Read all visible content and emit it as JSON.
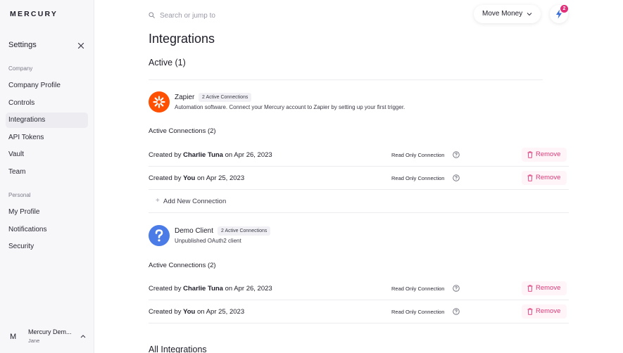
{
  "brand": "MERCURY",
  "sidebar": {
    "settings_title": "Settings",
    "company_label": "Company",
    "company_items": [
      "Company Profile",
      "Controls",
      "Integrations",
      "API Tokens",
      "Vault",
      "Team"
    ],
    "personal_label": "Personal",
    "personal_items": [
      "My Profile",
      "Notifications",
      "Security"
    ],
    "active_item": "Integrations",
    "account": {
      "avatar_letter": "M",
      "name": "Mercury Dem...",
      "user": "Jane"
    }
  },
  "topbar": {
    "search_placeholder": "Search or jump to",
    "move_money_label": "Move Money",
    "notifications_count": "2"
  },
  "main": {
    "title": "Integrations",
    "active_heading": "Active (1)",
    "all_heading": "All Integrations",
    "add_connection_label": "Add New Connection",
    "integrations": [
      {
        "name": "Zapier",
        "badge": "2 Active Connections",
        "description": "Automation software. Connect your Mercury account to Zapier by setting up your first trigger.",
        "logo_color": "#ff4f00",
        "connections_heading": "Active Connections (2)",
        "connections": [
          {
            "prefix": "Created by ",
            "creator": "Charlie Tuna",
            "suffix": " on Apr 26, 2023",
            "permission": "Read Only Connection",
            "action": "Remove"
          },
          {
            "prefix": "Created by ",
            "creator": "You",
            "suffix": " on Apr 25, 2023",
            "permission": "Read Only Connection",
            "action": "Remove"
          }
        ]
      },
      {
        "name": "Demo Client",
        "badge": "2 Active Connections",
        "description": "Unpublished OAuth2 client",
        "logo_color": "#4a7be6",
        "connections_heading": "Active Connections (2)",
        "connections": [
          {
            "prefix": "Created by ",
            "creator": "Charlie Tuna",
            "suffix": " on Apr 26, 2023",
            "permission": "Read Only Connection",
            "action": "Remove"
          },
          {
            "prefix": "Created by ",
            "creator": "You",
            "suffix": " on Apr 25, 2023",
            "permission": "Read Only Connection",
            "action": "Remove"
          }
        ]
      }
    ]
  },
  "colors": {
    "accent_pink": "#d93a78",
    "badge_pink": "#e0307a",
    "bolt_blue": "#3b6fd8"
  }
}
